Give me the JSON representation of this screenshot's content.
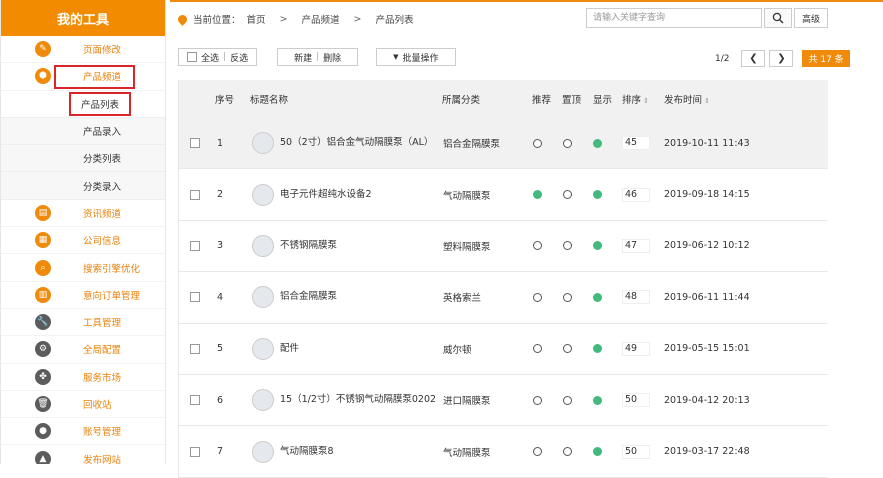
{
  "sidebar": {
    "title": "我的工具",
    "items": [
      {
        "label": "页面修改",
        "icon": "edit-icon",
        "dark": false
      },
      {
        "label": "产品频道",
        "icon": "product-channel-icon",
        "dark": false
      },
      {
        "label": "产品列表",
        "sub": true,
        "active": true
      },
      {
        "label": "产品录入",
        "sub": true
      },
      {
        "label": "分类列表",
        "sub": true
      },
      {
        "label": "分类录入",
        "sub": true
      },
      {
        "label": "资讯频道",
        "icon": "news-icon",
        "dark": false
      },
      {
        "label": "公司信息",
        "icon": "company-icon",
        "dark": false
      },
      {
        "label": "搜索引擎优化",
        "icon": "search-icon",
        "dark": false
      },
      {
        "label": "意向订单管理",
        "icon": "order-icon",
        "dark": false
      },
      {
        "label": "工具管理",
        "icon": "wrench-icon",
        "dark": true
      },
      {
        "label": "全局配置",
        "icon": "gear-icon",
        "dark": true
      },
      {
        "label": "服务市场",
        "icon": "grid-icon",
        "dark": true
      },
      {
        "label": "回收站",
        "icon": "trash-icon",
        "dark": true
      },
      {
        "label": "账号管理",
        "icon": "user-icon",
        "dark": true
      },
      {
        "label": "发布网站",
        "icon": "publish-icon",
        "dark": true
      }
    ]
  },
  "breadcrumb": {
    "prefix": "当前位置：",
    "parts": [
      "首页",
      "产品频道",
      "产品列表"
    ]
  },
  "search": {
    "placeholder": "请输入关键字查询",
    "advanced_label": "高级"
  },
  "toolbar": {
    "select_all": "全选",
    "invert": "反选",
    "new": "新建",
    "delete": "删除",
    "batch": "批量操作"
  },
  "pager": {
    "page": "1/2",
    "count": "共 17 条"
  },
  "table": {
    "headers": {
      "index": "序号",
      "title": "标题名称",
      "category": "所属分类",
      "recommend": "推荐",
      "top": "置顶",
      "show": "显示",
      "sort": "排序",
      "date": "发布时间"
    },
    "rows": [
      {
        "index": "1",
        "title": "50（2寸）铝合金气动隔膜泵（AL）",
        "category": "铝合金隔膜泵",
        "recommend": false,
        "top": false,
        "show": true,
        "sort": "45",
        "date": "2019-10-11 11:43"
      },
      {
        "index": "2",
        "title": "电子元件超纯水设备2",
        "category": "气动隔膜泵",
        "recommend": true,
        "top": false,
        "show": true,
        "sort": "46",
        "date": "2019-09-18 14:15"
      },
      {
        "index": "3",
        "title": "不锈钢隔膜泵",
        "category": "塑料隔膜泵",
        "recommend": false,
        "top": false,
        "show": true,
        "sort": "47",
        "date": "2019-06-12 10:12"
      },
      {
        "index": "4",
        "title": "铝合金隔膜泵",
        "category": "英格索兰",
        "recommend": false,
        "top": false,
        "show": true,
        "sort": "48",
        "date": "2019-06-11 11:44"
      },
      {
        "index": "5",
        "title": "配件",
        "category": "威尔顿",
        "recommend": false,
        "top": false,
        "show": true,
        "sort": "49",
        "date": "2019-05-15 15:01"
      },
      {
        "index": "6",
        "title": "15（1/2寸）不锈钢气动隔膜泵0202",
        "category": "进口隔膜泵",
        "recommend": false,
        "top": false,
        "show": true,
        "sort": "50",
        "date": "2019-04-12 20:13"
      },
      {
        "index": "7",
        "title": "气动隔膜泵8",
        "category": "气动隔膜泵",
        "recommend": false,
        "top": false,
        "show": true,
        "sort": "50",
        "date": "2019-03-17 22:48"
      }
    ]
  },
  "colors": {
    "accent": "#f08a0b",
    "status_green": "#42b97d",
    "highlight_red": "#d9262b"
  }
}
